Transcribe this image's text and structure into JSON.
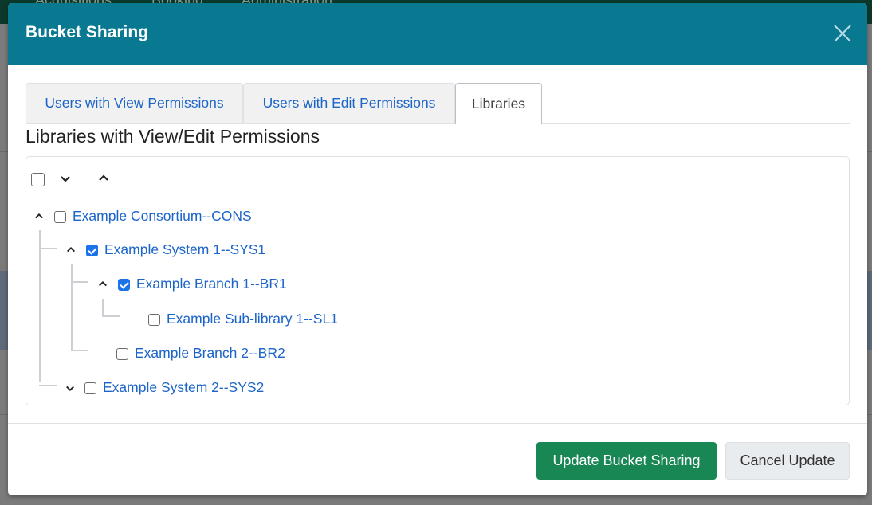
{
  "background": {
    "nav_items": [
      "Acquisitions",
      "Booking",
      "Administration"
    ]
  },
  "modal": {
    "title": "Bucket Sharing",
    "close_icon": "close-icon",
    "tabs": [
      {
        "label": "Users with View Permissions",
        "active": false
      },
      {
        "label": "Users with Edit Permissions",
        "active": false
      },
      {
        "label": "Libraries",
        "active": true
      }
    ],
    "section_title": "Libraries with View/Edit Permissions",
    "tree_toolbar": {
      "select_all_checked": false,
      "expand_all_icon": "chevron-down-icon",
      "collapse_all_icon": "chevron-up-icon"
    },
    "tree": [
      {
        "label": "Example Consortium--CONS",
        "checked": false,
        "expanded": true,
        "level": 0
      },
      {
        "label": "Example System 1--SYS1",
        "checked": true,
        "expanded": true,
        "level": 1
      },
      {
        "label": "Example Branch 1--BR1",
        "checked": true,
        "expanded": true,
        "level": 2
      },
      {
        "label": "Example Sub-library 1--SL1",
        "checked": false,
        "expanded": null,
        "level": 3
      },
      {
        "label": "Example Branch 2--BR2",
        "checked": false,
        "expanded": null,
        "level": 2
      },
      {
        "label": "Example System 2--SYS2",
        "checked": false,
        "expanded": false,
        "level": 1
      }
    ],
    "footer": {
      "primary_label": "Update Bucket Sharing",
      "secondary_label": "Cancel Update"
    },
    "colors": {
      "header": "#097891",
      "link": "#1b64c8",
      "primary_button": "#198754",
      "checkbox_checked": "#1a73e8"
    }
  }
}
